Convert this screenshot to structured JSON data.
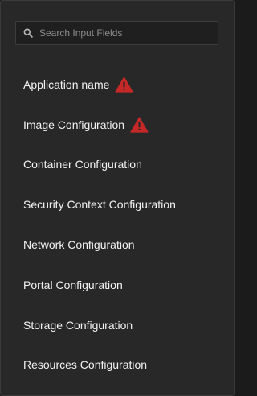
{
  "search": {
    "placeholder": "Search Input Fields",
    "value": "",
    "icon": "search-icon"
  },
  "nav": {
    "items": [
      {
        "label": "Application name",
        "warning": true
      },
      {
        "label": "Image Configuration",
        "warning": true
      },
      {
        "label": "Container Configuration",
        "warning": false
      },
      {
        "label": "Security Context Configuration",
        "warning": false
      },
      {
        "label": "Network Configuration",
        "warning": false
      },
      {
        "label": "Portal Configuration",
        "warning": false
      },
      {
        "label": "Storage Configuration",
        "warning": false
      },
      {
        "label": "Resources Configuration",
        "warning": false
      }
    ]
  },
  "colors": {
    "panel_background": "#282828",
    "text": "#f2f2f2",
    "warning": "#c62828"
  }
}
